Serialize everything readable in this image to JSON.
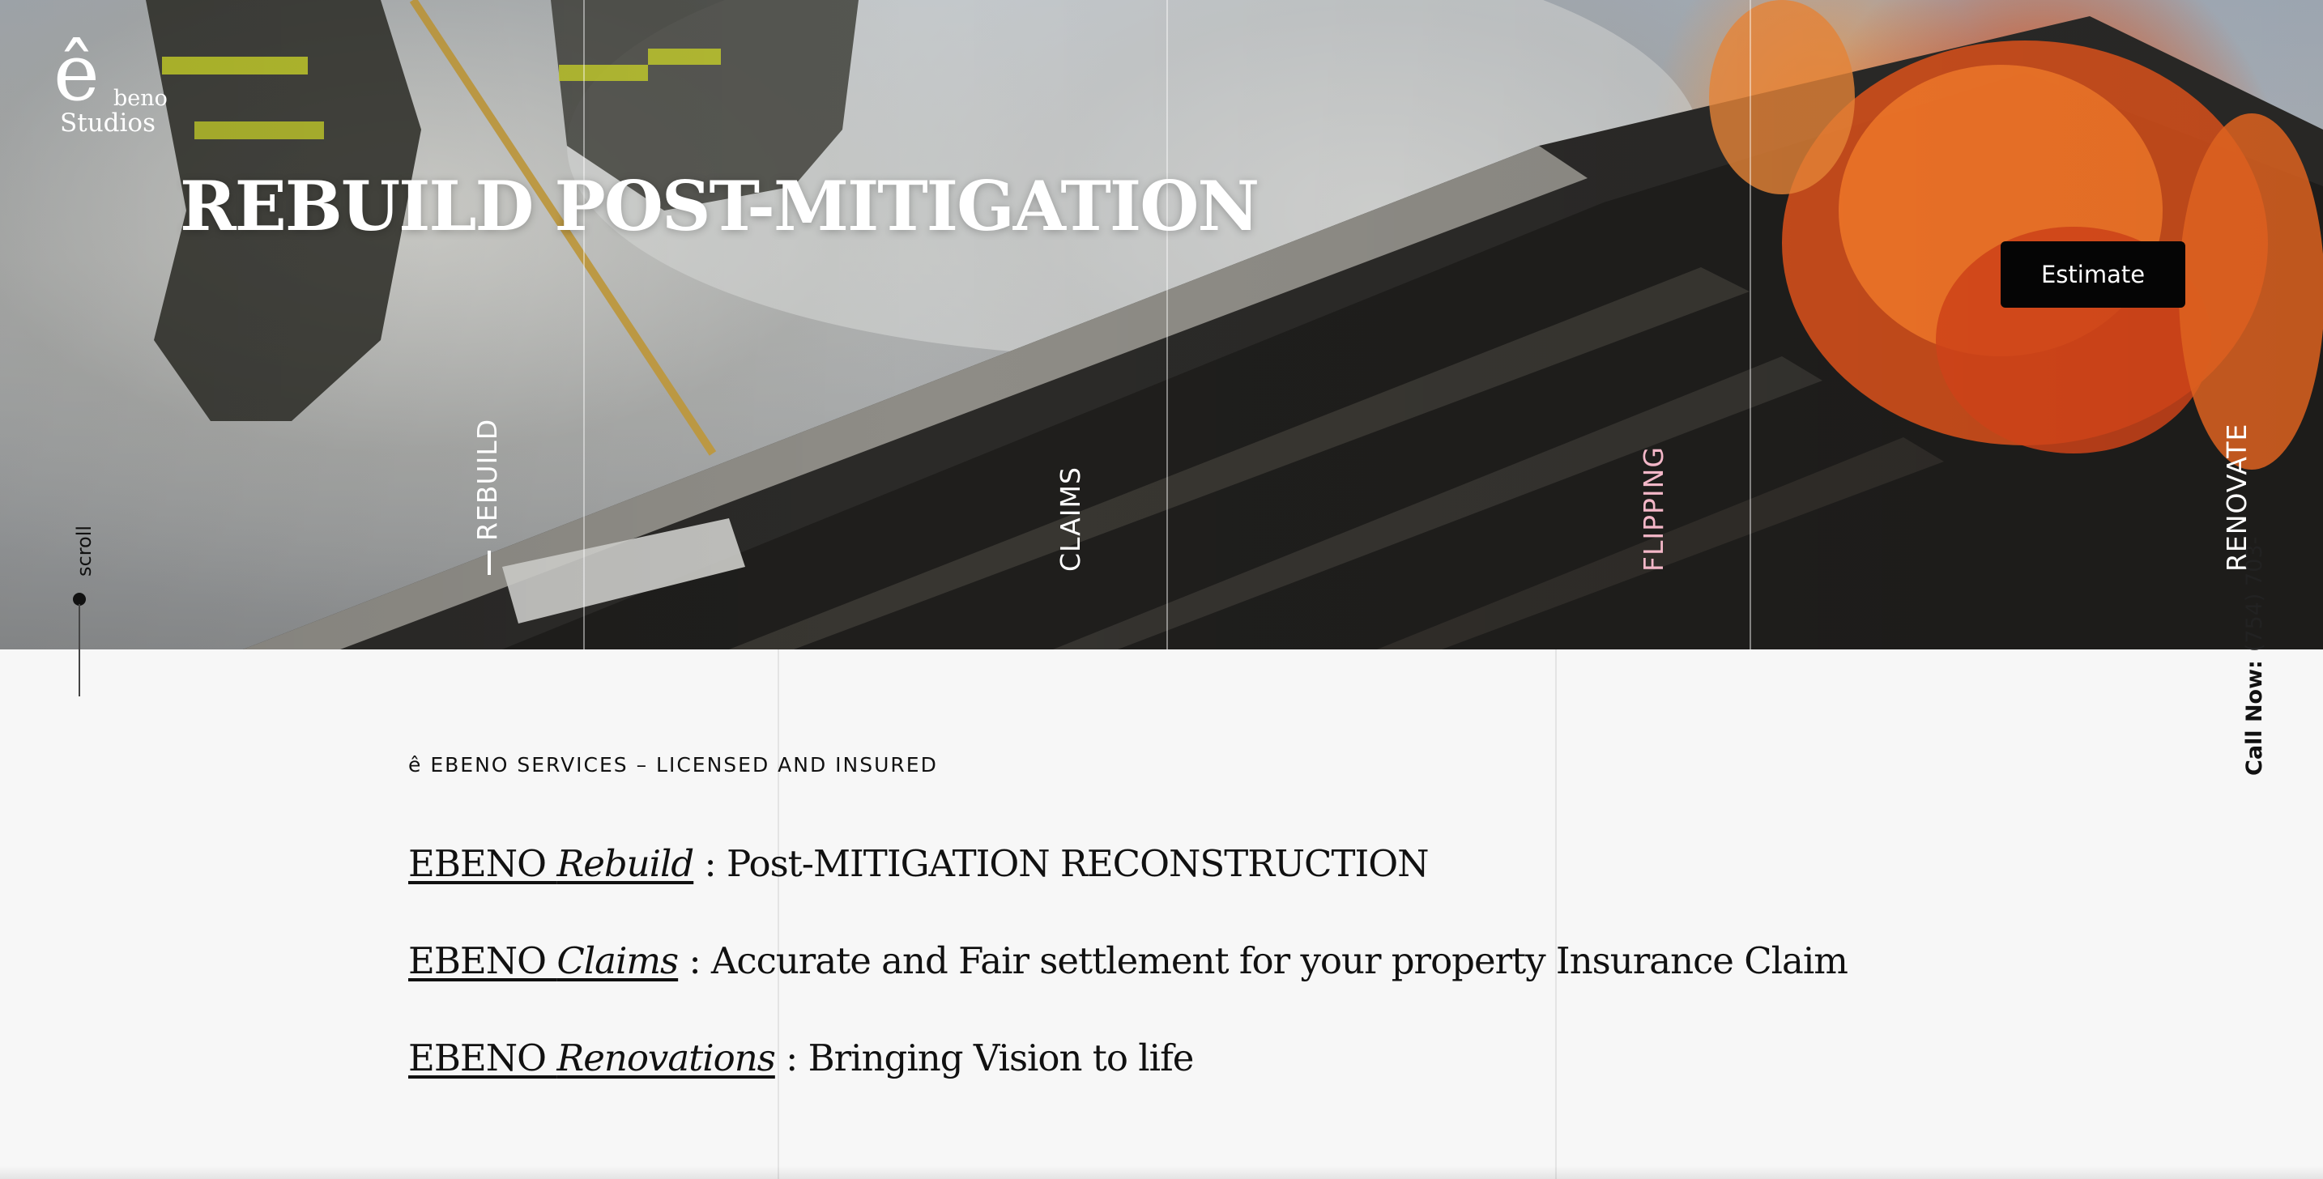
{
  "logo": {
    "e": "ê",
    "beno": "beno",
    "studios": "Studios"
  },
  "hero": {
    "title": "REBUILD POST-MITIGATION",
    "estimate_label": "Estimate"
  },
  "side_nav": [
    {
      "label": "REBUILD"
    },
    {
      "label": "CLAIMS"
    },
    {
      "label": "FLIPPING"
    },
    {
      "label": "RENOVATE"
    }
  ],
  "scroll_label": "scroll",
  "call": {
    "label": "Call Now:",
    "phone": "(754) 703-"
  },
  "services": {
    "eyebrow": "ê EBENO SERVICES – LICENSED AND INSURED",
    "items": [
      {
        "brand": "EBENO ",
        "name": "Rebuild",
        "description": " : Post-MITIGATION RECONSTRUCTION"
      },
      {
        "brand": "EBENO ",
        "name": "Claims",
        "description": " : Accurate and Fair settlement for your property Insurance Claim"
      },
      {
        "brand": "EBENO ",
        "name": "Renovations",
        "description": " : Bringing Vision to life"
      }
    ]
  },
  "colors": {
    "hero_text": "#ffffff",
    "button_bg": "#050505",
    "active_nav": "#f4b7c8",
    "page_bg": "#f7f7f7"
  }
}
